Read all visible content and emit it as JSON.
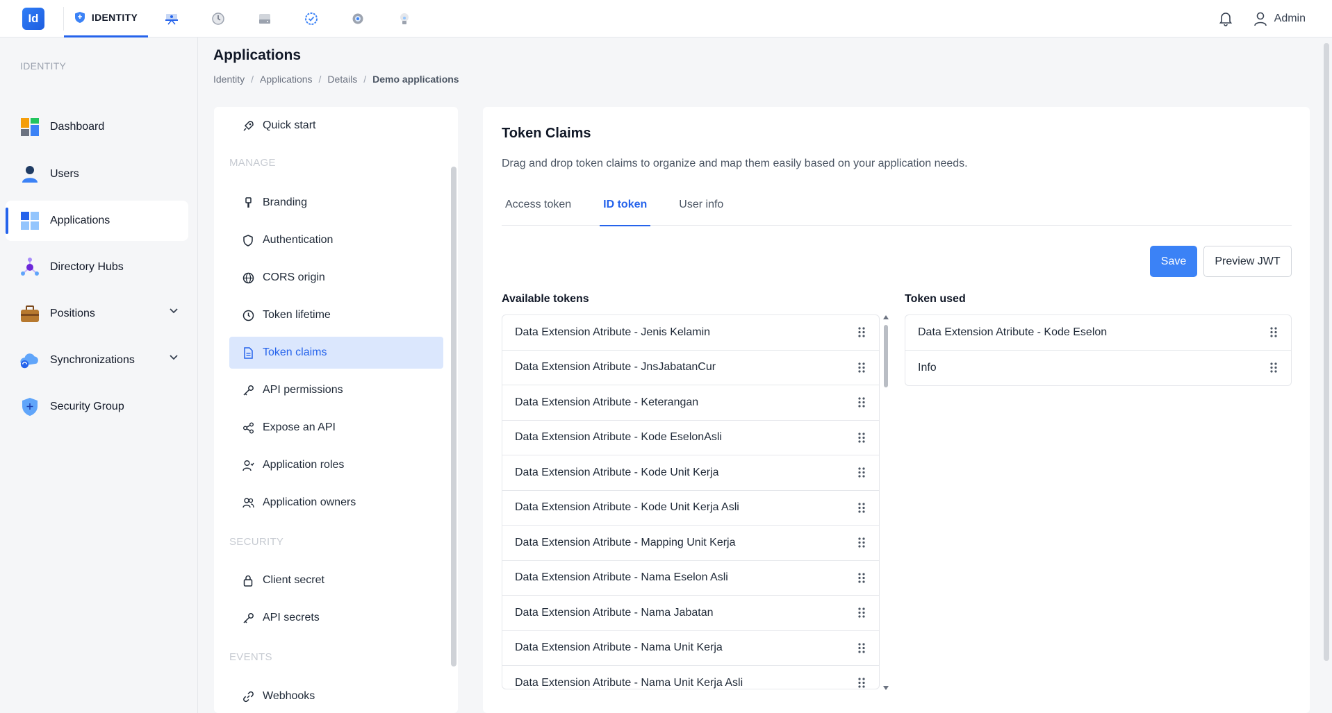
{
  "topbar": {
    "logo_text": "Id",
    "active_tab_label": "IDENTITY",
    "icons": [
      "shield-icon",
      "presentation-icon",
      "history-icon",
      "storage-icon",
      "check-circle-icon",
      "gear-icon",
      "bulb-icon"
    ],
    "user_label": "Admin"
  },
  "sidebar": {
    "section": "IDENTITY",
    "items": [
      {
        "label": "Dashboard"
      },
      {
        "label": "Users"
      },
      {
        "label": "Applications"
      },
      {
        "label": "Directory Hubs"
      },
      {
        "label": "Positions"
      },
      {
        "label": "Synchronizations"
      },
      {
        "label": "Security Group"
      }
    ]
  },
  "page": {
    "title": "Applications",
    "breadcrumb": [
      "Identity",
      "Applications",
      "Details",
      "Demo applications"
    ]
  },
  "menu": {
    "quick_start": "Quick start",
    "manage_section": "MANAGE",
    "manage": [
      "Branding",
      "Authentication",
      "CORS origin",
      "Token lifetime",
      "Token claims",
      "API permissions",
      "Expose an API",
      "Application roles",
      "Application owners"
    ],
    "security_section": "SECURITY",
    "security": [
      "Client secret",
      "API secrets"
    ],
    "events_section": "EVENTS",
    "events": [
      "Webhooks"
    ]
  },
  "card": {
    "title": "Token Claims",
    "description": "Drag and drop token claims to organize and map them easily based on your application needs.",
    "tabs": [
      "Access token",
      "ID token",
      "User info"
    ],
    "active_tab": "ID token",
    "save_label": "Save",
    "preview_label": "Preview JWT",
    "available_heading": "Available tokens",
    "used_heading": "Token used",
    "available_tokens": [
      "Data Extension Atribute - Jenis Kelamin",
      "Data Extension Atribute - JnsJabatanCur",
      "Data Extension Atribute - Keterangan",
      "Data Extension Atribute - Kode EselonAsli",
      "Data Extension Atribute - Kode Unit Kerja",
      "Data Extension Atribute - Kode Unit Kerja Asli",
      "Data Extension Atribute - Mapping Unit Kerja",
      "Data Extension Atribute - Nama Eselon Asli",
      "Data Extension Atribute - Nama Jabatan",
      "Data Extension Atribute - Nama Unit Kerja",
      "Data Extension Atribute - Nama Unit Kerja Asli"
    ],
    "used_tokens": [
      "Data Extension Atribute - Kode Eselon",
      "Info"
    ]
  }
}
